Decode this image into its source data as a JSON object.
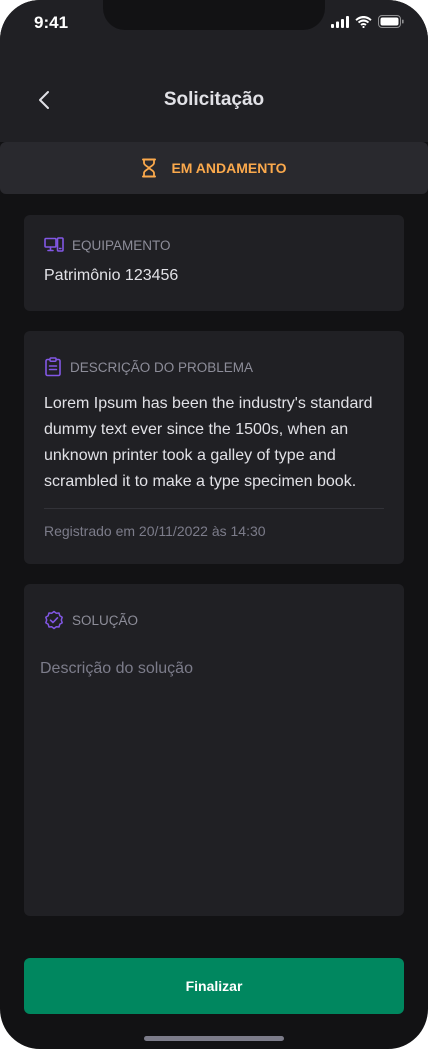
{
  "status_bar": {
    "time": "9:41"
  },
  "header": {
    "title": "Solicitação"
  },
  "status": {
    "label": "EM ANDAMENTO",
    "color": "#FBA94C",
    "icon": "hourglass-icon"
  },
  "equipment": {
    "label": "EQUIPAMENTO",
    "value": "Patrimônio 123456",
    "icon": "computer-phone-icon"
  },
  "problem": {
    "label": "DESCRIÇÃO DO PROBLEMA",
    "description": "Lorem Ipsum has been the industry's standard dummy text ever since the 1500s, when an unknown printer took a galley of type and scrambled it to make a type specimen book.",
    "registered": "Registrado em 20/11/2022 às 14:30",
    "icon": "clipboard-icon"
  },
  "solution": {
    "label": "SOLUÇÃO",
    "placeholder": "Descrição do solução",
    "icon": "check-badge-icon"
  },
  "actions": {
    "finish_label": "Finalizar"
  },
  "colors": {
    "accent_purple": "#8257E5",
    "status_orange": "#FBA94C",
    "primary_green": "#00875F"
  }
}
